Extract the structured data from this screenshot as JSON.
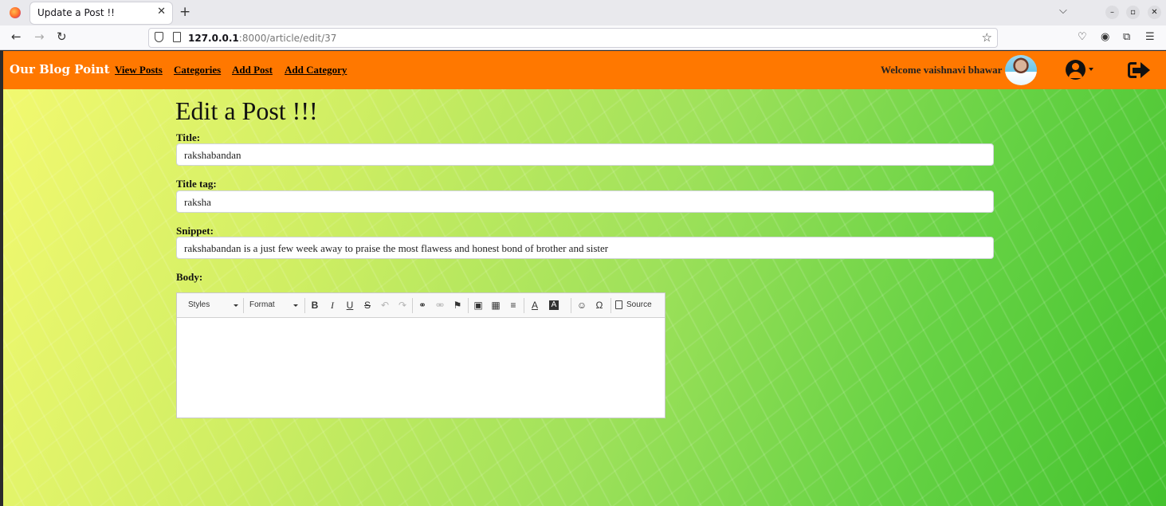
{
  "browser": {
    "tab_title": "Update a Post !!",
    "tab_close": "✕",
    "new_tab": "+",
    "tab_list": "⌵",
    "win_min": "–",
    "win_max": "▫",
    "win_close": "✕",
    "back": "←",
    "forward": "→",
    "reload": "↻",
    "url_host": "127.0.0.1",
    "url_path": ":8000/article/edit/37",
    "bookmark_star": "☆"
  },
  "nav": {
    "brand": "Our Blog Point",
    "links": [
      "View Posts",
      "Categories",
      "Add Post",
      "Add Category"
    ],
    "welcome": "Welcome vaishnavi bhawar"
  },
  "form": {
    "heading": "Edit a Post !!!",
    "title_label": "Title:",
    "title_value": "rakshabandan",
    "title_tag_label": "Title tag:",
    "title_tag_value": "raksha",
    "snippet_label": "Snippet:",
    "snippet_value": "rakshabandan is a just few week away to praise the most flawess and honest bond of brother and sister",
    "body_label": "Body:"
  },
  "editor": {
    "styles_label": "Styles",
    "format_label": "Format",
    "source_label": "Source",
    "icons": {
      "bold": "B",
      "italic": "I",
      "underline": "U",
      "strike": "S",
      "undo": "↶",
      "redo": "↷",
      "link": "⚭",
      "unlink": "⚮",
      "anchor": "⚑",
      "image": "▣",
      "table": "▦",
      "hr": "≡",
      "text_color": "A",
      "bg_color": "A",
      "smiley": "☺",
      "special_char": "Ω"
    }
  }
}
